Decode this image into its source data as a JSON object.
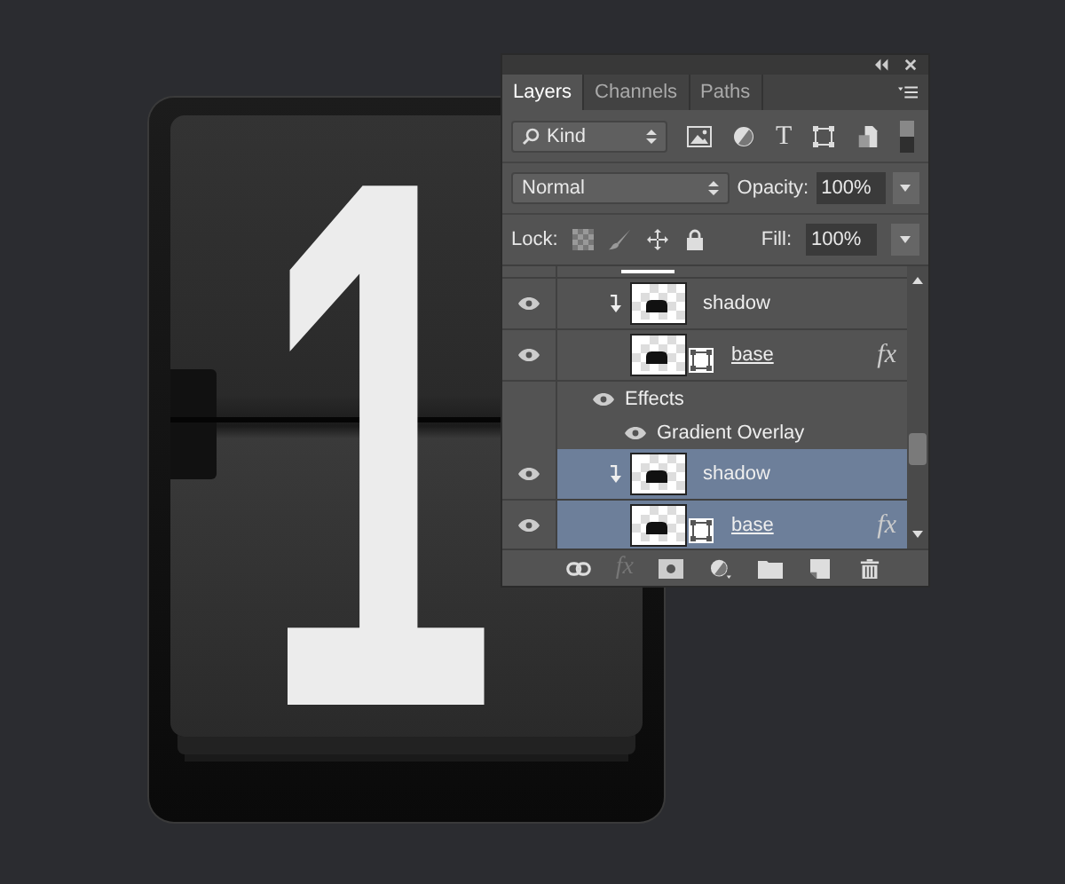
{
  "artwork": {
    "digit": "1"
  },
  "panel": {
    "tabs": [
      {
        "label": "Layers",
        "selected": true
      },
      {
        "label": "Channels",
        "selected": false
      },
      {
        "label": "Paths",
        "selected": false
      }
    ],
    "filter": {
      "value": "Kind",
      "icons": [
        {
          "kind": "pixel"
        },
        {
          "kind": "adjustment"
        },
        {
          "kind": "type",
          "label": "T"
        },
        {
          "kind": "shape"
        },
        {
          "kind": "smart"
        }
      ],
      "enabled": true
    },
    "blend_mode": "Normal",
    "opacity_label": "Opacity:",
    "opacity": "100%",
    "lock_label": "Lock:",
    "lock_icons": [
      {
        "kind": "transparent"
      },
      {
        "kind": "brush"
      },
      {
        "kind": "move"
      },
      {
        "kind": "all"
      }
    ],
    "fill_label": "Fill:",
    "fill": "100%",
    "layers": [
      {
        "kind": "layer",
        "name": "shadow",
        "visible": true,
        "clipped": true,
        "vector_mask": false,
        "underlined": false,
        "selected": false
      },
      {
        "kind": "layer",
        "name": "base",
        "visible": true,
        "clipped": false,
        "vector_mask": true,
        "underlined": true,
        "fx": "fx",
        "selected": false
      },
      {
        "kind": "effects",
        "name": "Effects",
        "visible": true
      },
      {
        "kind": "effect",
        "name": "Gradient Overlay",
        "visible": true
      },
      {
        "kind": "layer",
        "name": "shadow",
        "visible": true,
        "clipped": true,
        "vector_mask": false,
        "underlined": false,
        "selected": true
      },
      {
        "kind": "layer",
        "name": "base",
        "visible": true,
        "clipped": false,
        "vector_mask": true,
        "underlined": true,
        "fx": "fx",
        "selected": true
      }
    ],
    "toolbar": [
      {
        "kind": "link"
      },
      {
        "kind": "fx",
        "label": "fx",
        "disabled": true
      },
      {
        "kind": "mask"
      },
      {
        "kind": "adjustment"
      },
      {
        "kind": "folder"
      },
      {
        "kind": "new"
      },
      {
        "kind": "trash"
      }
    ]
  }
}
